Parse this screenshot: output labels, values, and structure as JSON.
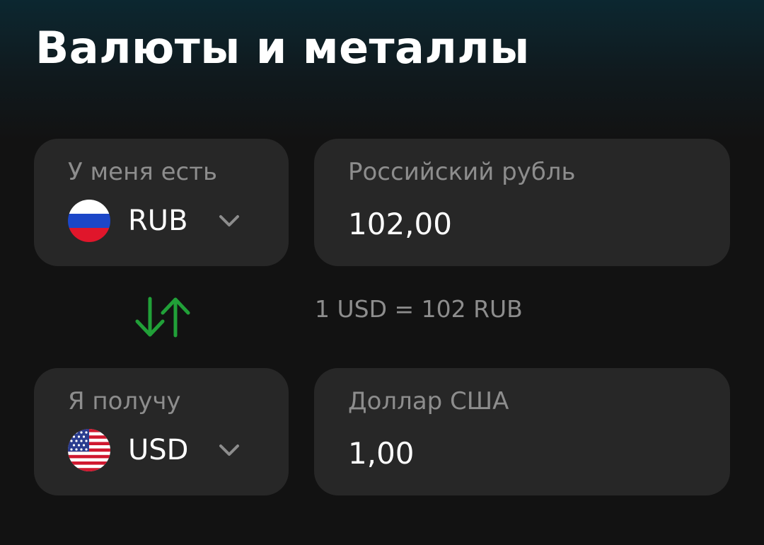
{
  "header": {
    "title": "Валюты и металлы"
  },
  "from": {
    "label": "У меня есть",
    "currency_code": "RUB",
    "currency_name": "Российский рубль",
    "amount": "102,00",
    "flag_icon": "russia-flag-icon"
  },
  "rate": {
    "text": "1 USD = 102 RUB"
  },
  "to": {
    "label": "Я получу",
    "currency_code": "USD",
    "currency_name": "Доллар США",
    "amount": "1,00",
    "flag_icon": "usa-flag-icon"
  },
  "icons": {
    "swap": "swap-arrows-icon",
    "dropdown": "chevron-down-icon"
  },
  "colors": {
    "background": "#121212",
    "card": "#272727",
    "label": "#8d8d8d",
    "accent_green": "#21a038",
    "text": "#ffffff"
  }
}
